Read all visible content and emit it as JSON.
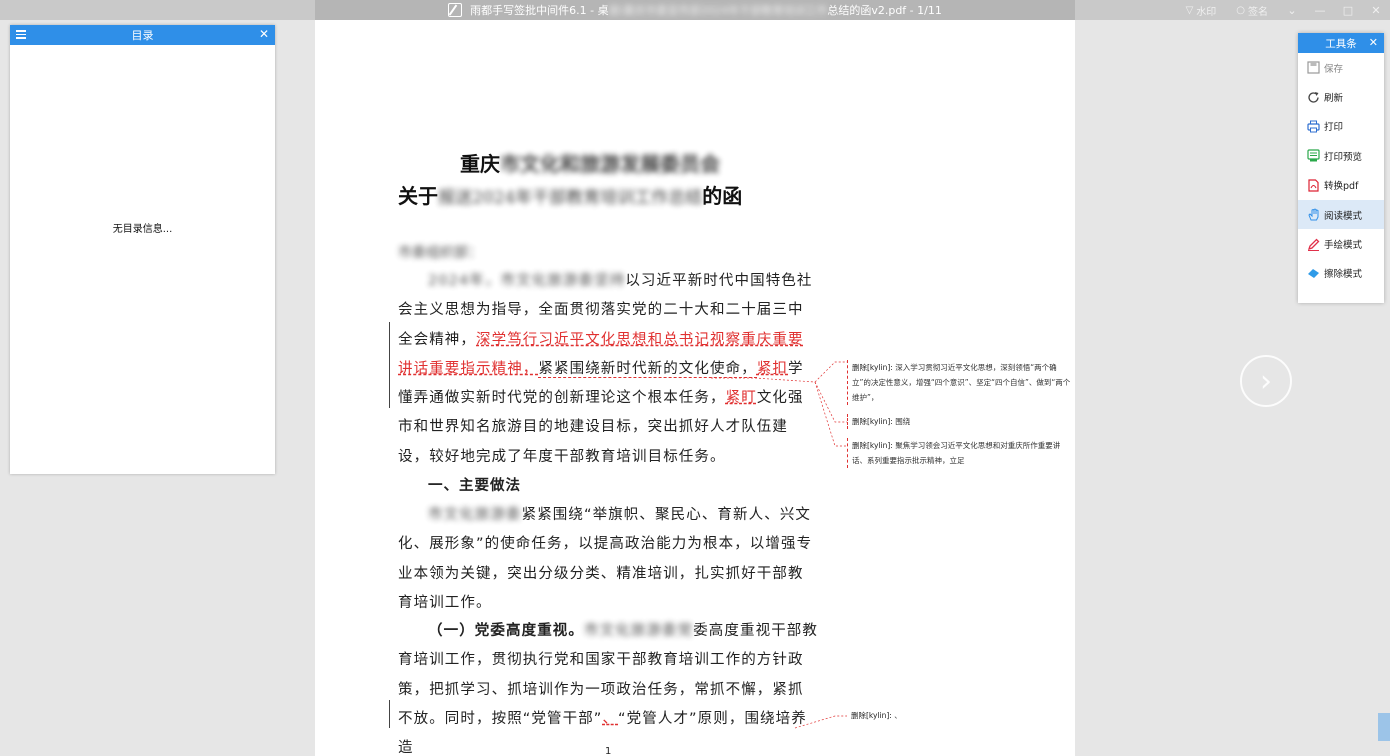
{
  "titlebar": {
    "title_prefix": "雨都手写签批中间件6.1 - 桌",
    "title_blurred": "面\\重庆市委宣传部2024年干部教育培训工作",
    "title_suffix": "总结的函v2.pdf - 1/11",
    "watermark_label": "水印",
    "sign_label": "签名",
    "min_label": "—",
    "max_label": "□",
    "close_label": "✕",
    "dropdown_label": "⌄"
  },
  "toc": {
    "title": "目录",
    "close": "✕",
    "empty_message": "无目录信息..."
  },
  "nav": {
    "prev": "‹",
    "next": "›"
  },
  "document": {
    "heading_line1_visible": "重庆",
    "heading_line1_blurred": "市文化和旅游发展委员会",
    "heading_line2_prefix": "关于",
    "heading_line2_blurred": "报送2024年干部教育培训工作总结",
    "heading_line2_suffix": "的函",
    "addressee_blurred": "市委组织部：",
    "p1_blurred": "2024年，市文化旅游委坚持",
    "p1_a": "以习近平新时代中国特色社会主义思想为指导，全面贯彻落实党的二十大和二十届三中全会精神，",
    "p1_red1": "深学笃行习近平文化思想和总书记视察重庆重要讲话重要指示精神，",
    "p1_b": "紧紧围绕新时代新的文化使命，",
    "p1_red2": "紧扣",
    "p1_c": "学懂弄通做实新时代党的创新理论这个根本任务，",
    "p1_red3": "紧盯",
    "p1_d": "文化强市和世界知名旅游目的地建设目标，突出抓好人才队伍建设，较好地完成了年度干部教育培训目标任务。",
    "section1": "一、主要做法",
    "p2_blurred": "市文化旅游委",
    "p2": "紧紧围绕“举旗帜、聚民心、育新人、兴文化、展形象”的使命任务，以提高政治能力为根本，以增强专业本领为关键，突出分级分类、精准培训，扎实抓好干部教育培训工作。",
    "p3_bold": "（一）党委高度重视。",
    "p3_blurred": "市文化旅游委党",
    "p3": "委高度重视干部教育培训工作，贯彻执行党和国家干部教育培训工作的方针政策，把抓学习、抓培训作为一项政治任务，常抓不懈，紧抓不放。同时，按照“党管干部”",
    "p3_red": "、",
    "p3_end": "“党管人才”原则，围绕培养造",
    "page_number": "1"
  },
  "comments": [
    {
      "who": "删除[kylin]:",
      "text": "深入学习贯彻习近平文化思想，深刻领悟“两个确立”的决定性意义，增强“四个意识”、坚定“四个自信”、做到“两个维护”，"
    },
    {
      "who": "删除[kylin]:",
      "text": "围绕"
    },
    {
      "who": "删除[kylin]:",
      "text": "聚焦学习领会习近平文化思想和对重庆所作重要讲话、系列重要指示批示精神，立足"
    },
    {
      "who": "删除[kylin]:",
      "text": "、"
    }
  ],
  "toolbox": {
    "title": "工具条",
    "close": "✕",
    "items": [
      {
        "label": "保存",
        "icon": "save-icon"
      },
      {
        "label": "刷新",
        "icon": "refresh-icon"
      },
      {
        "label": "打印",
        "icon": "print-icon"
      },
      {
        "label": "打印预览",
        "icon": "print-preview-icon"
      },
      {
        "label": "转换pdf",
        "icon": "pdf-icon"
      },
      {
        "label": "阅读模式",
        "icon": "hand-icon"
      },
      {
        "label": "手绘模式",
        "icon": "pen-icon"
      },
      {
        "label": "擦除模式",
        "icon": "eraser-icon"
      }
    ]
  },
  "colors": {
    "accent": "#2f8fe8",
    "revision": "#e03030"
  }
}
